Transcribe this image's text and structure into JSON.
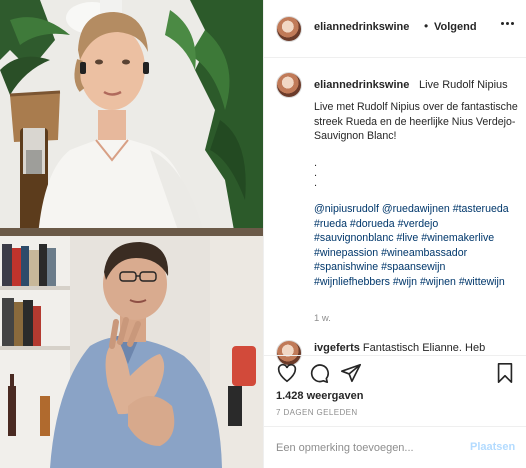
{
  "colors": {
    "link": "#00376b",
    "muted": "#8e8e8e",
    "post_disabled": "#b3dbff",
    "divider": "#efefef"
  },
  "header": {
    "username": "eliannedrinkswine",
    "separator": "•",
    "follow_label": "Volgend",
    "more_icon": "more-horizontal-icon"
  },
  "caption": {
    "username": "eliannedrinkswine",
    "title": "Live Rudolf Nipius",
    "text": "Live met Rudolf Nipius over de fantastische streek Rueda en de heerlijke Nius Verdejo-Sauvignon Blanc!",
    "dots": ".\n.\n.",
    "tags": "@nipiusrudolf @ruedawijnen #tasterueda #rueda #dorueda #verdejo #sauvignonblanc #live #winemakerlive #winepassion #wineambassador #spanishwine #spaansewijn #wijnliefhebbers #wijn #wijnen #wittewijn",
    "time": "1 w."
  },
  "comment": {
    "username": "ivgeferts",
    "text": "Fantastisch Elianne. Heb"
  },
  "actions": {
    "like_icon": "heart-icon",
    "comment_icon": "comment-icon",
    "share_icon": "share-icon",
    "save_icon": "bookmark-icon"
  },
  "stats": {
    "views": "1.428 weergaven",
    "date": "7 DAGEN GELEDEN"
  },
  "add_comment": {
    "placeholder": "Een opmerking toevoegen...",
    "post_label": "Plaatsen"
  }
}
